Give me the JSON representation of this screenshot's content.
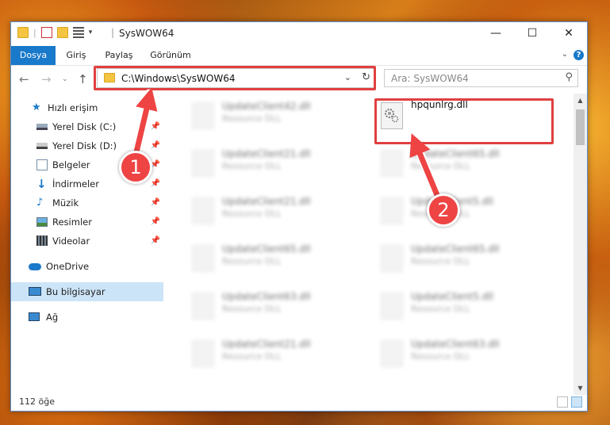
{
  "window": {
    "title": "SysWOW64",
    "controls": {
      "minimize": "—",
      "maximize": "☐",
      "close": "✕"
    }
  },
  "ribbon": {
    "tabs": [
      {
        "label": "Dosya",
        "active": true
      },
      {
        "label": "Giriş",
        "active": false
      },
      {
        "label": "Paylaş",
        "active": false
      },
      {
        "label": "Görünüm",
        "active": false
      }
    ],
    "help": "?"
  },
  "address": {
    "path": "C:\\Windows\\SysWOW64"
  },
  "search": {
    "placeholder": "Ara: SysWOW64"
  },
  "sidebar": {
    "items": [
      {
        "label": "Hızlı erişim",
        "icon": "star-icon",
        "pinned": false
      },
      {
        "label": "Yerel Disk (C:)",
        "icon": "disk-icon",
        "pinned": true
      },
      {
        "label": "Yerel Disk (D:)",
        "icon": "disk-icon",
        "pinned": true
      },
      {
        "label": "Belgeler",
        "icon": "documents-icon",
        "pinned": true
      },
      {
        "label": "İndirmeler",
        "icon": "download-icon",
        "pinned": true
      },
      {
        "label": "Müzik",
        "icon": "music-icon",
        "pinned": true
      },
      {
        "label": "Resimler",
        "icon": "pictures-icon",
        "pinned": true
      },
      {
        "label": "Videolar",
        "icon": "videos-icon",
        "pinned": true
      },
      {
        "label": "OneDrive",
        "icon": "cloud-icon",
        "pinned": false
      },
      {
        "label": "Bu bilgisayar",
        "icon": "computer-icon",
        "pinned": false,
        "selected": true
      },
      {
        "label": "Ağ",
        "icon": "network-icon",
        "pinned": false
      }
    ]
  },
  "files": {
    "left": [
      {
        "name": "UpdateClient42.dll",
        "desc": "Resource DLL"
      },
      {
        "name": "UpdateClient21.dll",
        "desc": "Resource DLL"
      },
      {
        "name": "UpdateClient21.dll",
        "desc": "Resource DLL"
      },
      {
        "name": "UpdateClient65.dll",
        "desc": "Resource DLL"
      },
      {
        "name": "UpdateClient63.dll",
        "desc": "Resource DLL"
      },
      {
        "name": "UpdateClient21.dll",
        "desc": "Resource DLL"
      }
    ],
    "right": [
      {
        "name": "hpqunlrg.dll",
        "desc": ""
      },
      {
        "name": "UpdateClient65.dll",
        "desc": "Resource DLL"
      },
      {
        "name": "UpdateClient5.dll",
        "desc": "Resource DLL"
      },
      {
        "name": "UpdateClient65.dll",
        "desc": "Resource DLL"
      },
      {
        "name": "UpdateClient5.dll",
        "desc": "Resource DLL"
      },
      {
        "name": "UpdateClient63.dll",
        "desc": "Resource DLL"
      }
    ]
  },
  "status": {
    "count": "112 öğe"
  },
  "callouts": [
    "1",
    "2"
  ],
  "colors": {
    "accent": "#1979ca",
    "highlight": "#e04040",
    "selected": "#cce4f7"
  }
}
